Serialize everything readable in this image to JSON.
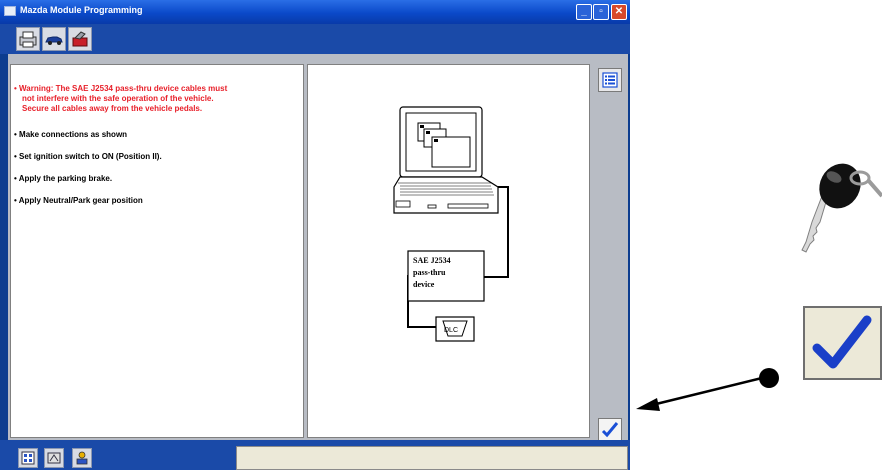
{
  "window": {
    "title": "Mazda Module Programming",
    "controls": {
      "minimize": "_",
      "maximize": "▫",
      "close": "✕"
    }
  },
  "toolbar": {
    "tabs": [
      {
        "name": "printer-icon"
      },
      {
        "name": "car-icon"
      },
      {
        "name": "toolbox-icon"
      }
    ]
  },
  "instructions": {
    "warning_lines": [
      "• Warning: The SAE J2534 pass-thru device cables must",
      "not interfere with the safe operation of the vehicle.",
      "Secure all cables away from the vehicle pedals."
    ],
    "steps": [
      "• Make connections as shown",
      "• Set ignition switch to ON (Position II).",
      "• Apply the parking brake.",
      "• Apply Neutral/Park gear position"
    ]
  },
  "diagram": {
    "device_label_lines": [
      "SAE J2534",
      "pass-thru",
      "device"
    ],
    "dlc_label": "DLC"
  },
  "buttons": {
    "list_icon": "list-icon",
    "confirm_icon": "checkmark-icon"
  },
  "bottom": {
    "tabs": [
      {
        "name": "layout-icon"
      },
      {
        "name": "module-icon"
      },
      {
        "name": "user-computer-icon"
      }
    ],
    "status_text": ""
  },
  "colors": {
    "title_bar": "#0a49c9",
    "frame": "#0d3d8f",
    "warning_text": "#e8202a",
    "checkmark": "#1a4fd6"
  }
}
